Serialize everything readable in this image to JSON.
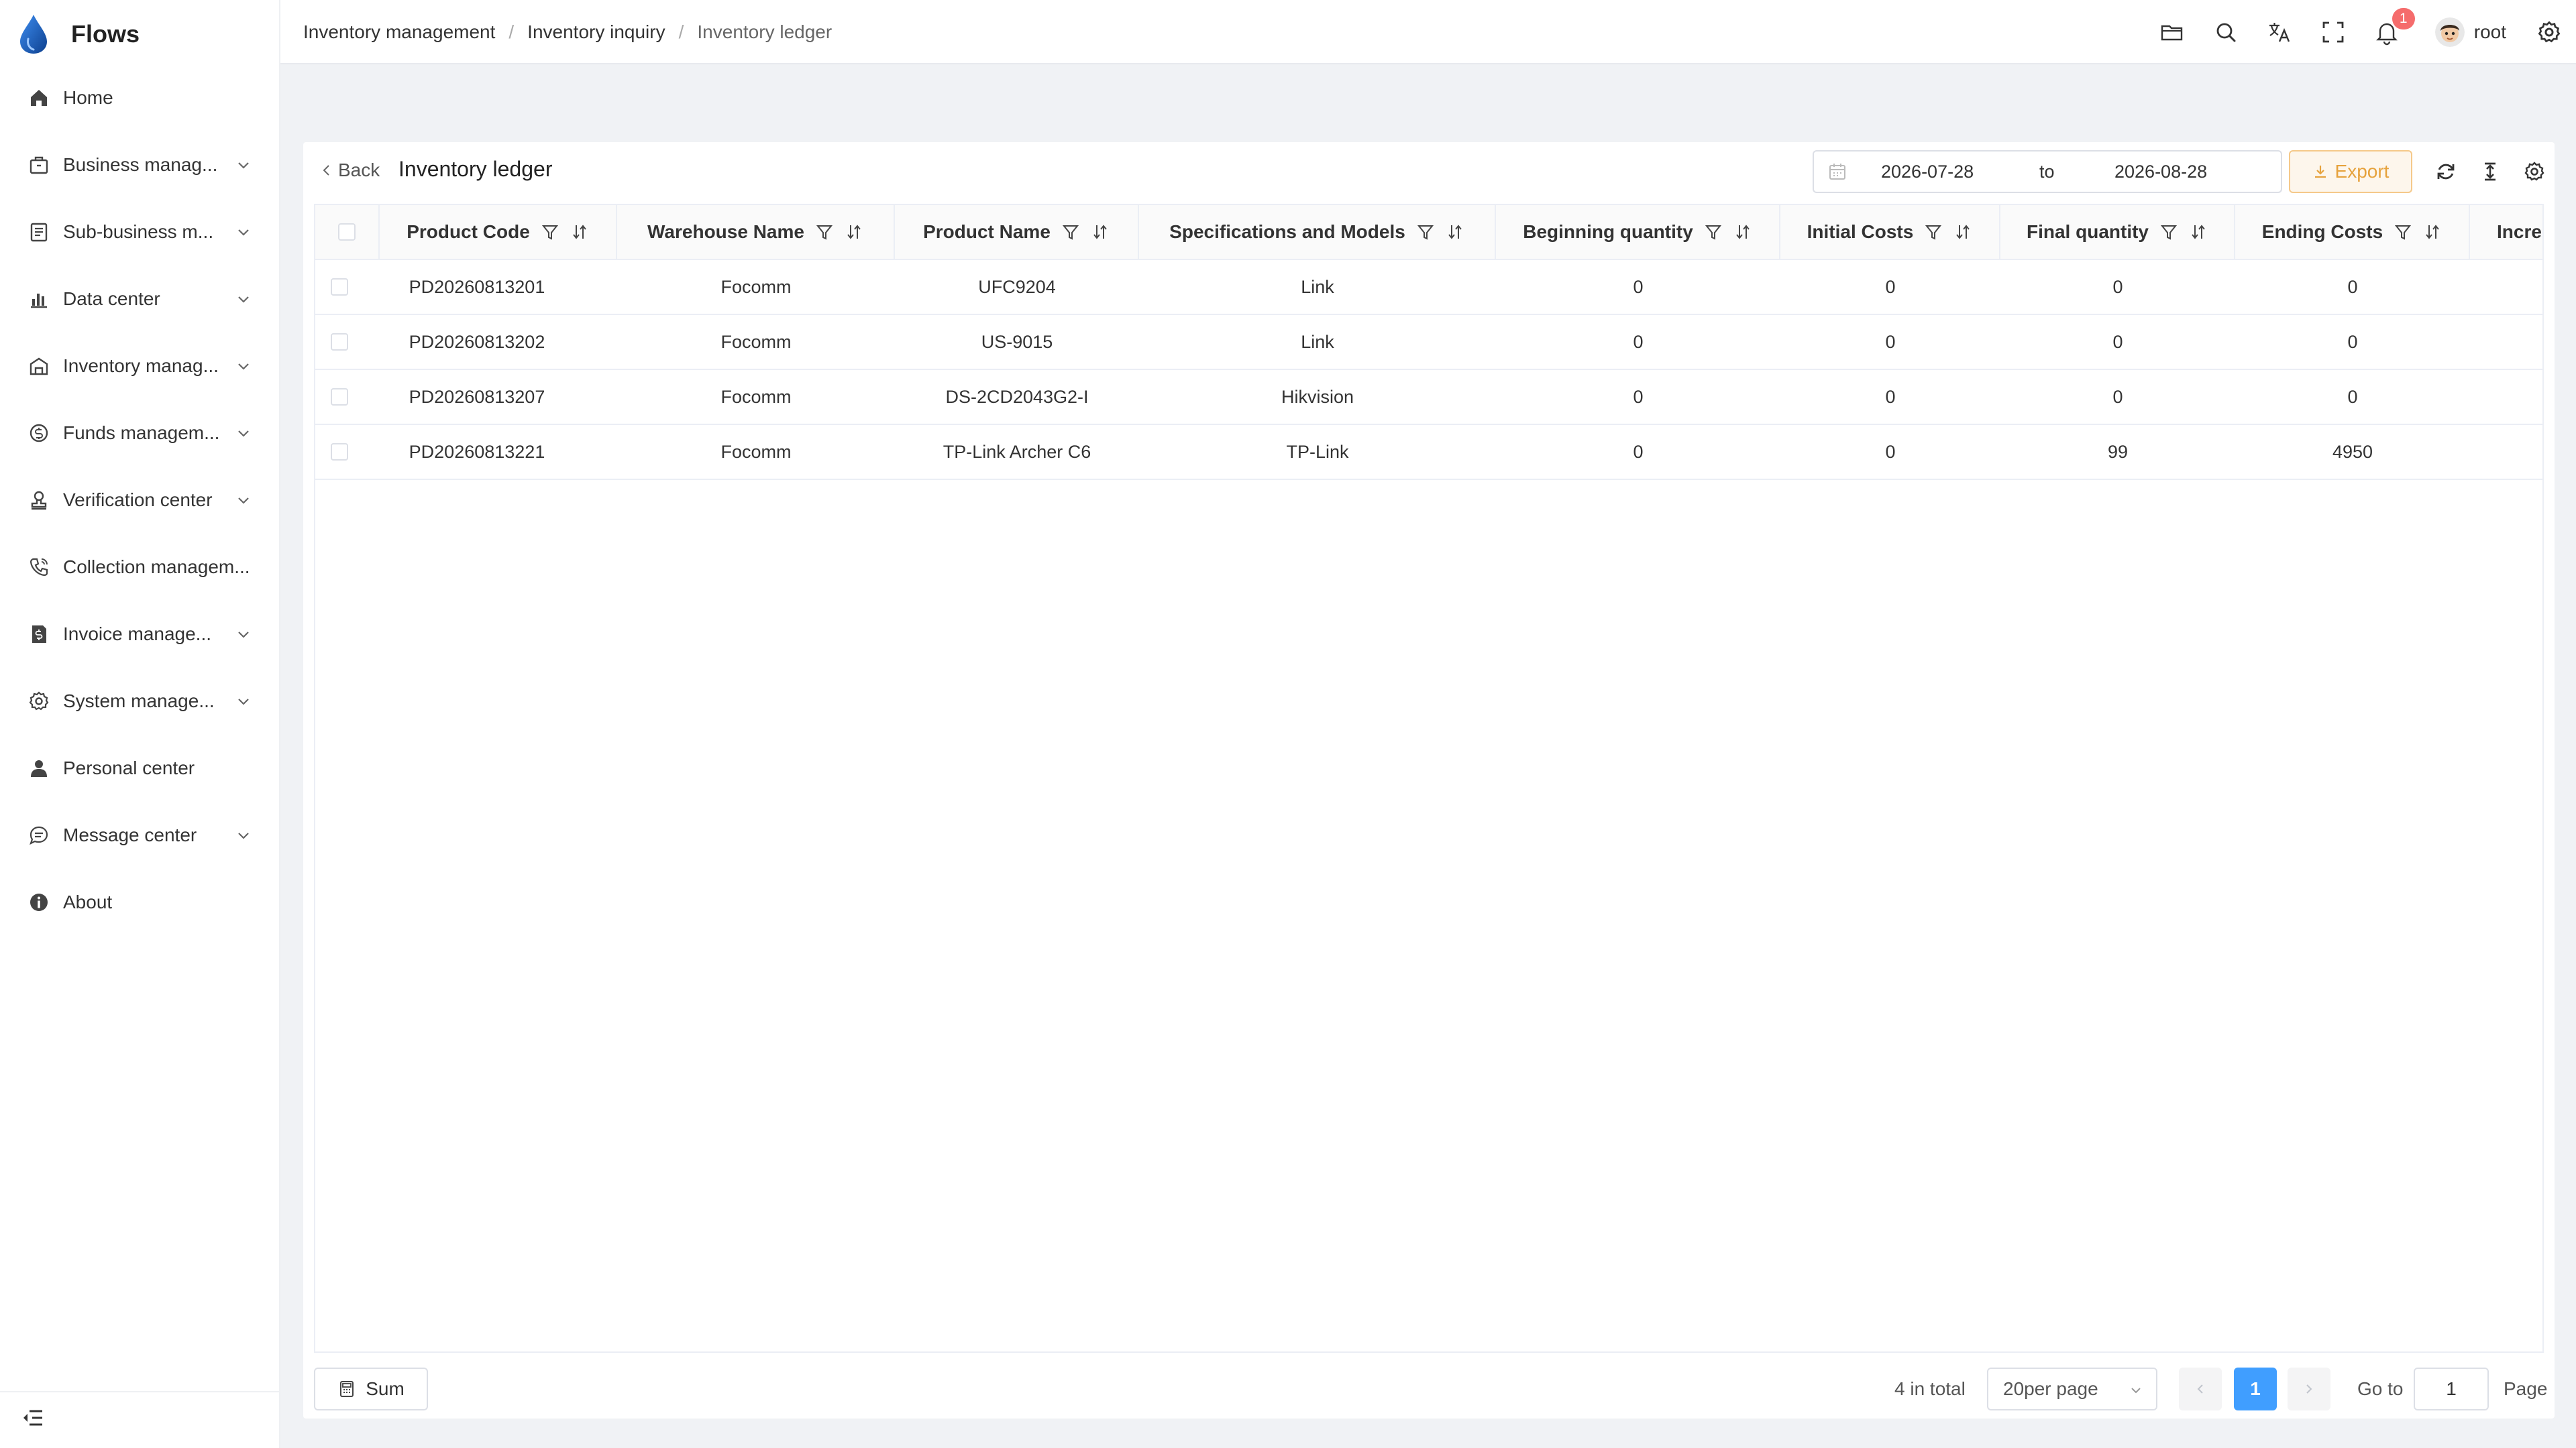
{
  "app": {
    "name": "Flows"
  },
  "sidebar": {
    "items": [
      {
        "label": "Home",
        "icon": "home-icon",
        "has_children": false
      },
      {
        "label": "Business manag...",
        "icon": "briefcase-icon",
        "has_children": true
      },
      {
        "label": "Sub-business m...",
        "icon": "document-icon",
        "has_children": true
      },
      {
        "label": "Data center",
        "icon": "bar-chart-icon",
        "has_children": true
      },
      {
        "label": "Inventory manag...",
        "icon": "warehouse-icon",
        "has_children": true
      },
      {
        "label": "Funds managem...",
        "icon": "coin-icon",
        "has_children": true
      },
      {
        "label": "Verification center",
        "icon": "stamp-icon",
        "has_children": true
      },
      {
        "label": "Collection managem...",
        "icon": "phone-icon",
        "has_children": false
      },
      {
        "label": "Invoice manage...",
        "icon": "invoice-icon",
        "has_children": true
      },
      {
        "label": "System manage...",
        "icon": "gear-icon",
        "has_children": true
      },
      {
        "label": "Personal center",
        "icon": "user-icon",
        "has_children": false
      },
      {
        "label": "Message center",
        "icon": "message-icon",
        "has_children": true
      },
      {
        "label": "About",
        "icon": "info-icon",
        "has_children": false
      }
    ]
  },
  "header": {
    "breadcrumb": [
      "Inventory management",
      "Inventory inquiry",
      "Inventory ledger"
    ],
    "notification_count": "1",
    "username": "root"
  },
  "panel": {
    "back_label": "Back",
    "title": "Inventory ledger",
    "date_start": "2026-07-28",
    "date_to": "to",
    "date_end": "2026-08-28",
    "export_label": "Export"
  },
  "table": {
    "columns": [
      "Product Code",
      "Warehouse Name",
      "Product Name",
      "Specifications and Models",
      "Beginning quantity",
      "Initial Costs",
      "Final quantity",
      "Ending Costs",
      "Incre"
    ],
    "rows": [
      [
        "PD20260813201",
        "Focomm",
        "UFC9204",
        "Link",
        "0",
        "0",
        "0",
        "0"
      ],
      [
        "PD20260813202",
        "Focomm",
        "US-9015",
        "Link",
        "0",
        "0",
        "0",
        "0"
      ],
      [
        "PD20260813207",
        "Focomm",
        "DS-2CD2043G2-I",
        "Hikvision",
        "0",
        "0",
        "0",
        "0"
      ],
      [
        "PD20260813221",
        "Focomm",
        "TP-Link Archer C6",
        "TP-Link",
        "0",
        "0",
        "99",
        "4950"
      ]
    ]
  },
  "footer": {
    "sum_label": "Sum",
    "total_text": "4 in total",
    "page_size": "20per page",
    "current_page": "1",
    "goto_label": "Go to",
    "goto_value": "1",
    "page_label": "Page"
  },
  "colors": {
    "primary": "#409eff",
    "export": "#e6a23c",
    "badge": "#f56c6c",
    "logo": "#1f6fd1"
  }
}
